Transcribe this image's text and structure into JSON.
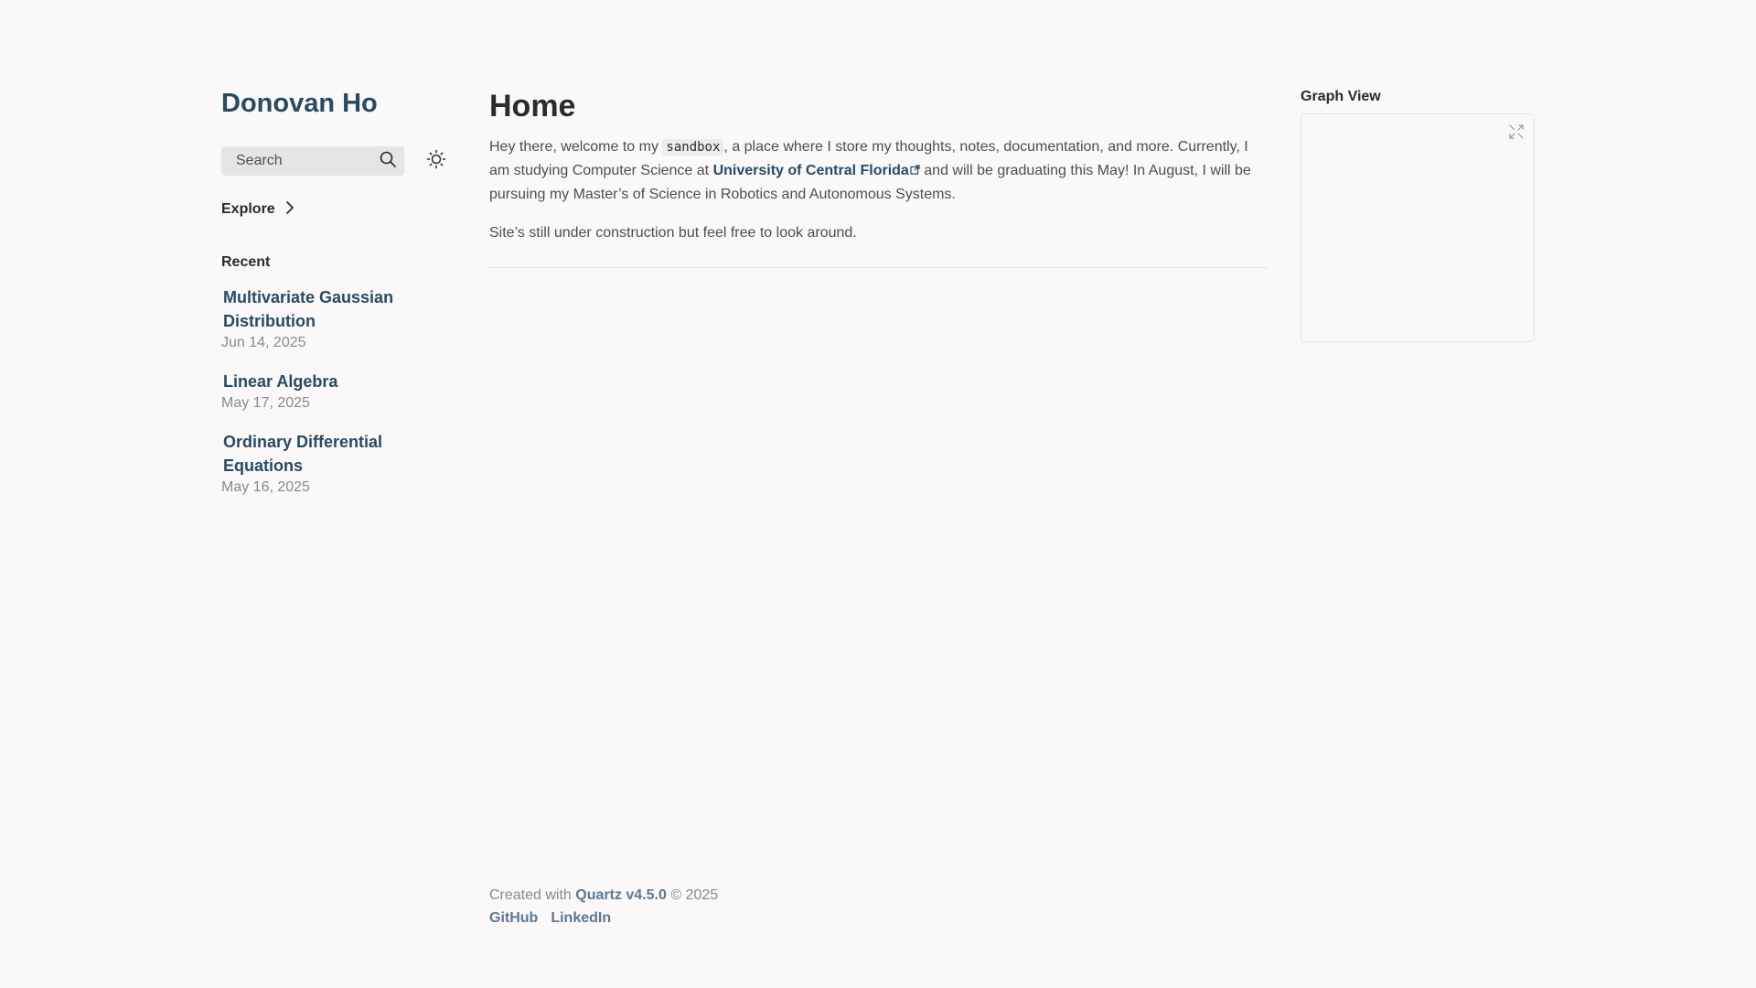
{
  "site": {
    "title": "Donovan Ho"
  },
  "search": {
    "placeholder": "Search"
  },
  "explorer": {
    "label": "Explore"
  },
  "recent": {
    "heading": "Recent",
    "items": [
      {
        "title": "Multivariate Gaussian Distribution",
        "date": "Jun 14, 2025"
      },
      {
        "title": "Linear Algebra",
        "date": "May 17, 2025"
      },
      {
        "title": "Ordinary Differential Equations",
        "date": "May 16, 2025"
      }
    ]
  },
  "page": {
    "title": "Home",
    "p1_a": "Hey there, welcome to my ",
    "p1_code": "sandbox",
    "p1_b": ", a place where I store my thoughts, notes, documentation, and more. Currently, I am studying Computer Science at ",
    "p1_link": "University of Central Florida",
    "p1_c": " and will be graduating this May! In August, I will be pursuing my Master’s of Science in Robotics and Autonomous Systems.",
    "p2": "Site’s still under construction but feel free to look around."
  },
  "graph": {
    "heading": "Graph View"
  },
  "footer": {
    "created_prefix": "Created with ",
    "quartz_link": "Quartz v4.5.0",
    "created_suffix": " © 2025",
    "links": [
      "GitHub",
      "LinkedIn"
    ]
  },
  "icons": {
    "search": "search-icon",
    "theme": "sun-icon",
    "explore": "chevron-right-icon",
    "external": "external-link-icon",
    "graph_expand": "expand-icon"
  },
  "colors": {
    "background": "#faf8f8",
    "accent": "#284b63",
    "text": "#4e4e4e",
    "heading": "#2b2b2b",
    "muted": "#8a8a8a"
  }
}
